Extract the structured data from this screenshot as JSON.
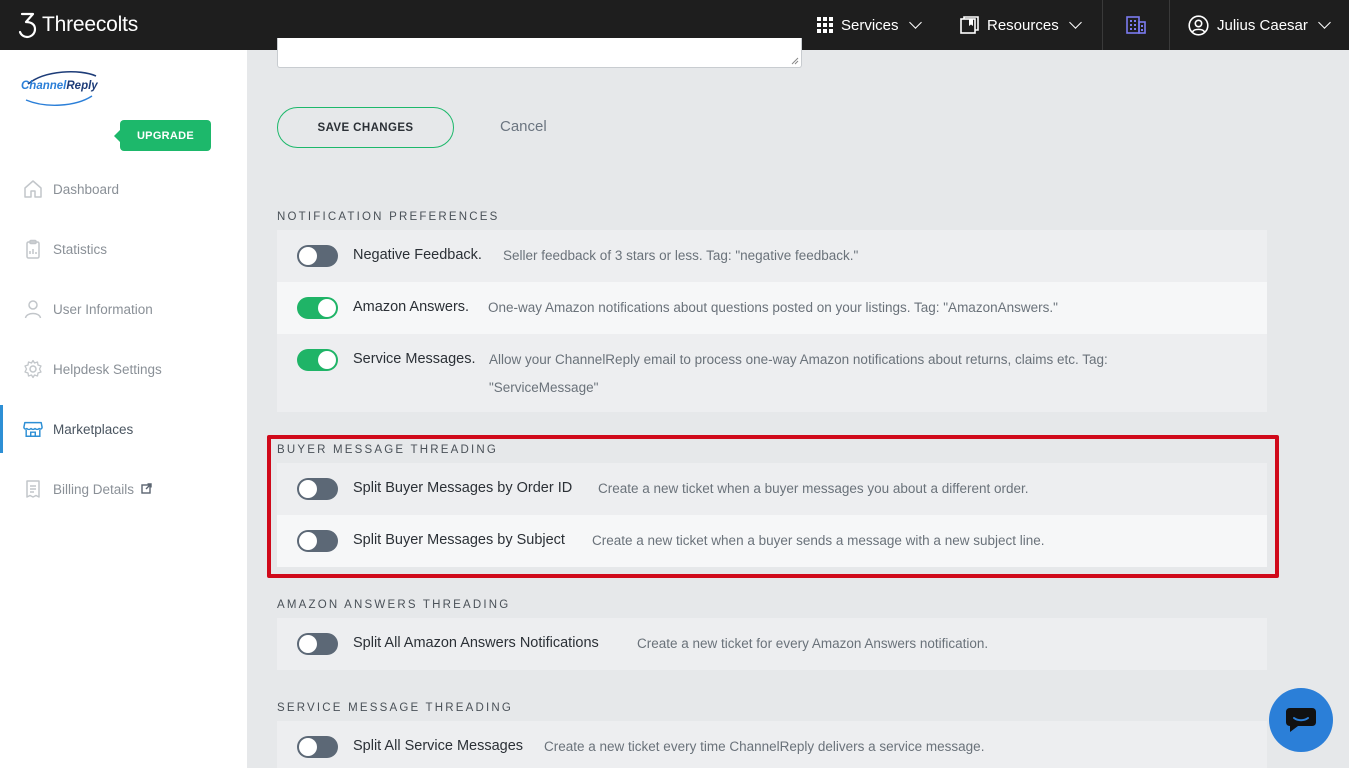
{
  "topbar": {
    "brand": "Threecolts",
    "services_label": "Services",
    "resources_label": "Resources",
    "user_name": "Julius Caesar",
    "building_icon": "building-icon"
  },
  "sidebar": {
    "logo_text": "ChannelReply",
    "upgrade_label": "UPGRADE",
    "items": [
      {
        "label": "Dashboard",
        "icon": "home-icon"
      },
      {
        "label": "Statistics",
        "icon": "clipboard-icon"
      },
      {
        "label": "User Information",
        "icon": "user-icon"
      },
      {
        "label": "Helpdesk Settings",
        "icon": "gear-icon"
      },
      {
        "label": "Marketplaces",
        "icon": "store-icon",
        "active": true
      },
      {
        "label": "Billing Details",
        "icon": "invoice-icon",
        "external": true
      }
    ]
  },
  "actions": {
    "save_label": "SAVE CHANGES",
    "cancel_label": "Cancel"
  },
  "notification": {
    "title": "NOTIFICATION PREFERENCES",
    "rows": [
      {
        "label": "Negative Feedback.",
        "desc": "Seller feedback of 3 stars or less. Tag: \"negative feedback.\"",
        "on": false
      },
      {
        "label": "Amazon Answers.",
        "desc": "One-way Amazon notifications about questions posted on your listings. Tag: \"AmazonAnswers.\"",
        "on": true
      },
      {
        "label": "Service Messages.",
        "desc": "Allow your ChannelReply email to process one-way Amazon notifications about returns, claims etc. Tag:",
        "desc2": "\"ServiceMessage\"",
        "on": true
      }
    ]
  },
  "buyer": {
    "title": "BUYER MESSAGE THREADING",
    "rows": [
      {
        "label": "Split Buyer Messages by Order ID",
        "desc": "Create a new ticket when a buyer messages you about a different order.",
        "on": false
      },
      {
        "label": "Split Buyer Messages by Subject",
        "desc": "Create a new ticket when a buyer sends a message with a new subject line.",
        "on": false
      }
    ]
  },
  "answers": {
    "title": "AMAZON ANSWERS THREADING",
    "rows": [
      {
        "label": "Split All Amazon Answers Notifications",
        "desc": "Create a new ticket for every Amazon Answers notification.",
        "on": false
      }
    ]
  },
  "service": {
    "title": "SERVICE MESSAGE THREADING",
    "rows": [
      {
        "label": "Split All Service Messages",
        "desc": "Create a new ticket every time ChannelReply delivers a service message.",
        "on": false
      }
    ]
  },
  "colors": {
    "accent_green": "#1db86b",
    "highlight_red": "#d0091a",
    "chat_blue": "#2b7fd8"
  }
}
